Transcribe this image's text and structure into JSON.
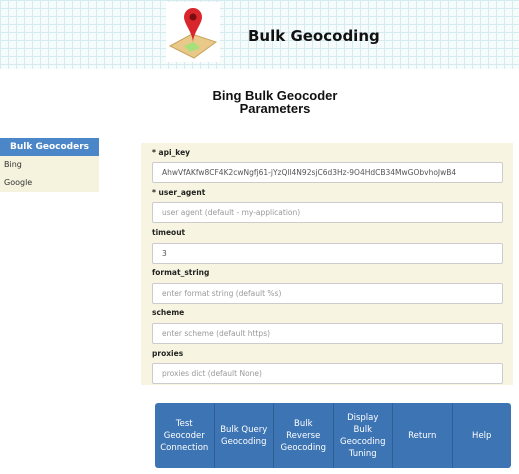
{
  "header": {
    "title": "Bulk Geocoding"
  },
  "page": {
    "subtitle_line1": "Bing Bulk Geocoder",
    "subtitle_line2": "Parameters"
  },
  "sidebar": {
    "heading": "Bulk Geocoders",
    "items": [
      {
        "label": "Bing"
      },
      {
        "label": "Google"
      }
    ]
  },
  "form": {
    "fields": [
      {
        "label": "* api_key",
        "value": "AhwVfAKfw8CF4K2cwNgfj61-jYzQll4N92sjC6d3Hz-9O4HdCB34MwGObvhoJwB4",
        "placeholder": ""
      },
      {
        "label": "* user_agent",
        "value": "",
        "placeholder": "user agent (default - my-application)"
      },
      {
        "label": "timeout",
        "value": "3",
        "placeholder": ""
      },
      {
        "label": "format_string",
        "value": "",
        "placeholder": "enter format string (default %s)"
      },
      {
        "label": "scheme",
        "value": "",
        "placeholder": "enter scheme (default https)"
      },
      {
        "label": "proxies",
        "value": "",
        "placeholder": "proxies dict (default None)"
      }
    ]
  },
  "buttons": [
    {
      "label": "Test Geocoder Connection"
    },
    {
      "label": "Bulk Query Geocoding"
    },
    {
      "label": "Bulk Reverse Geocoding"
    },
    {
      "label": "Display Bulk Geocoding Tuning"
    },
    {
      "label": "Return"
    },
    {
      "label": "Help"
    }
  ]
}
